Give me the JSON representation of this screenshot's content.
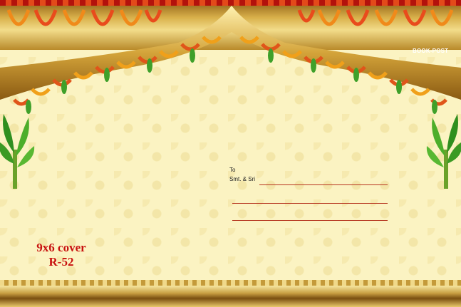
{
  "stamp": {
    "text": "BOOK-POST"
  },
  "address": {
    "to_label": "To",
    "name_label": "Smt. & Sri"
  },
  "product": {
    "size_label": "9x6 cover",
    "code_label": "R-52"
  },
  "colors": {
    "gold": "#d8b04a",
    "cream": "#fbf3c2",
    "red_text": "#c8120f",
    "garland_orange": "#f08a1a",
    "leaf_green": "#3fa02a"
  }
}
